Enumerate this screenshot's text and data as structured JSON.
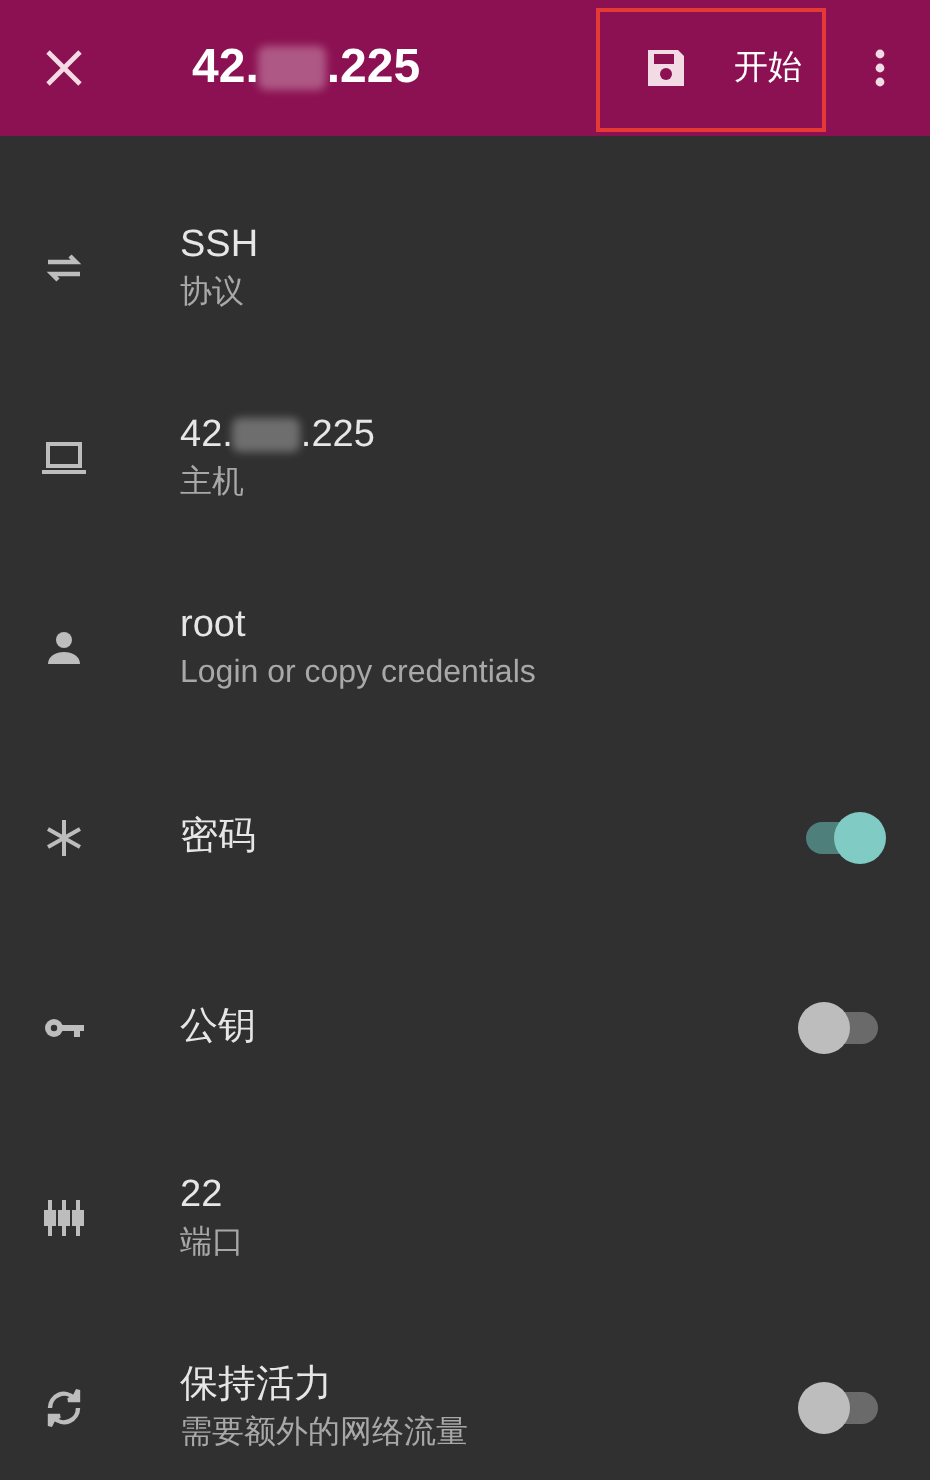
{
  "toolbar": {
    "title_start": "42.",
    "title_end": ".225",
    "action_label": "开始",
    "highlighted": true
  },
  "rows": [
    {
      "kind": "text",
      "primary": "SSH",
      "secondary": "协议"
    },
    {
      "kind": "host",
      "primary_start": "42.",
      "primary_end": ".225",
      "secondary": "主机"
    },
    {
      "kind": "text",
      "primary": "root",
      "secondary": "Login or copy credentials"
    },
    {
      "kind": "toggle",
      "primary": "密码",
      "on": true
    },
    {
      "kind": "toggle",
      "primary": "公钥",
      "on": false
    },
    {
      "kind": "text",
      "primary": "22",
      "secondary": "端口"
    },
    {
      "kind": "toggle",
      "primary": "保持活力",
      "secondary": "需要额外的网络流量",
      "on": false
    }
  ]
}
